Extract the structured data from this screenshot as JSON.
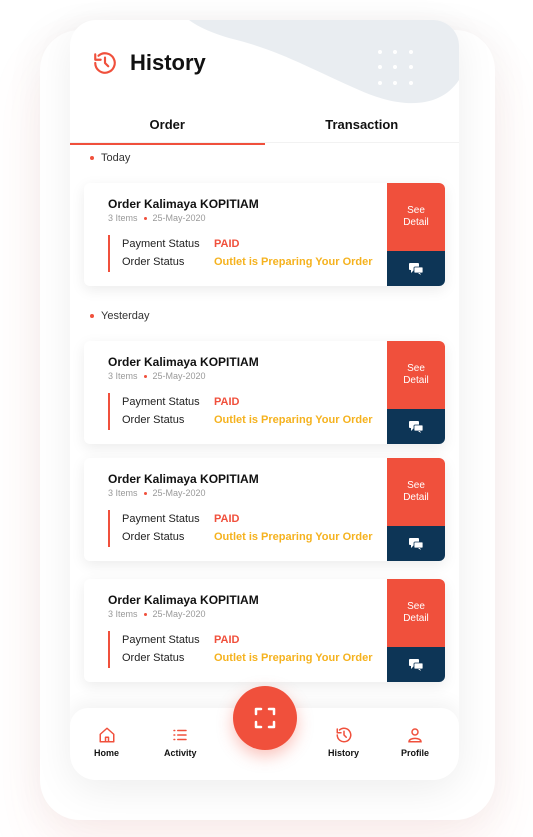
{
  "colors": {
    "accent": "#f0503c",
    "navy": "#0d3556",
    "status_yellow": "#f5b21e"
  },
  "header": {
    "icon": "history-icon",
    "title": "History"
  },
  "tabs": [
    {
      "label": "Order",
      "active": true
    },
    {
      "label": "Transaction",
      "active": false
    }
  ],
  "sections": [
    {
      "label": "Today"
    },
    {
      "label": "Yesterday"
    }
  ],
  "orders": [
    {
      "title": "Order Kalimaya KOPITIAM",
      "items": "3 Items",
      "date": "25-May-2020",
      "payment_label": "Payment Status",
      "payment_value": "PAID",
      "order_label": "Order Status",
      "order_value": "Outlet is Preparing Your Order",
      "detail_label_1": "See",
      "detail_label_2": "Detail"
    },
    {
      "title": "Order Kalimaya KOPITIAM",
      "items": "3 Items",
      "date": "25-May-2020",
      "payment_label": "Payment Status",
      "payment_value": "PAID",
      "order_label": "Order Status",
      "order_value": "Outlet is Preparing Your Order",
      "detail_label_1": "See",
      "detail_label_2": "Detail"
    },
    {
      "title": "Order Kalimaya KOPITIAM",
      "items": "3 Items",
      "date": "25-May-2020",
      "payment_label": "Payment Status",
      "payment_value": "PAID",
      "order_label": "Order Status",
      "order_value": "Outlet is Preparing Your Order",
      "detail_label_1": "See",
      "detail_label_2": "Detail"
    },
    {
      "title": "Order Kalimaya KOPITIAM",
      "items": "3 Items",
      "date": "25-May-2020",
      "payment_label": "Payment Status",
      "payment_value": "PAID",
      "order_label": "Order Status",
      "order_value": "Outlet is Preparing Your Order",
      "detail_label_1": "See",
      "detail_label_2": "Detail"
    }
  ],
  "nav": {
    "home": "Home",
    "activity": "Activity",
    "history": "History",
    "profile": "Profile",
    "scan_icon": "scan-icon"
  }
}
